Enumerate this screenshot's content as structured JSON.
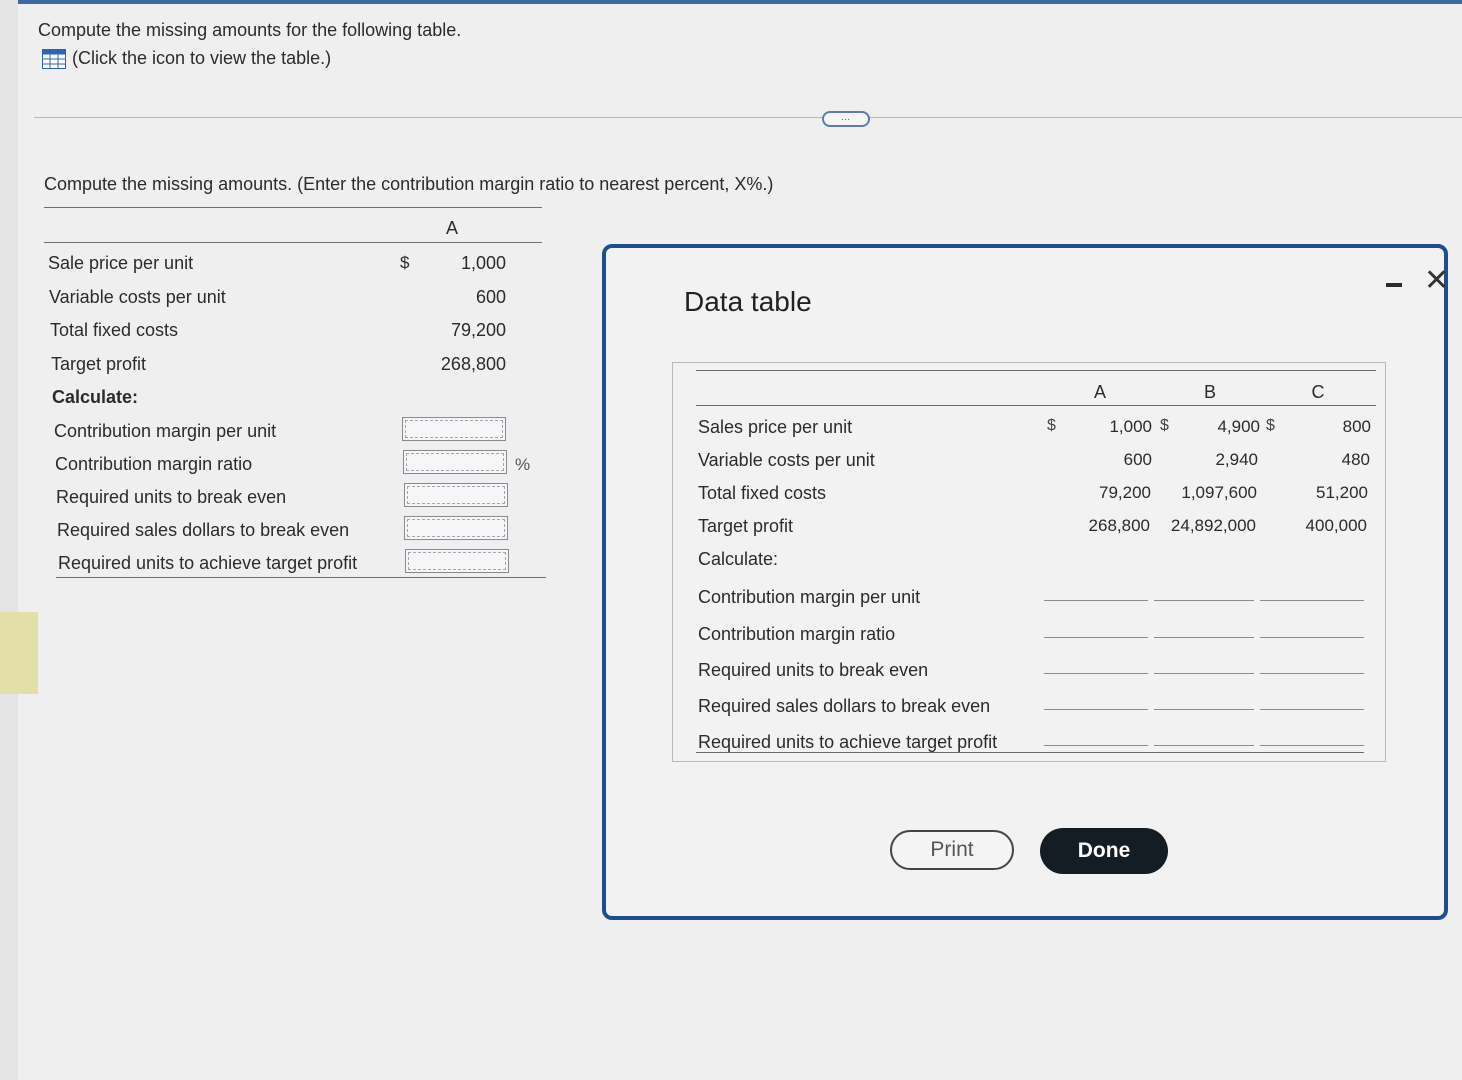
{
  "instruction": "Compute the missing amounts for the following table.",
  "icon_link": {
    "icon": "grid-table-icon",
    "label": "(Click the icon to view the table.)"
  },
  "more_button": "…",
  "question": "Compute the missing amounts. (Enter the contribution margin ratio to nearest percent, X%.)",
  "answer_table": {
    "column_header": "A",
    "dollar_sign": "$",
    "rows": [
      {
        "label": "Sale price per unit",
        "value": "1,000"
      },
      {
        "label": "Variable costs per unit",
        "value": "600"
      },
      {
        "label": "Total fixed costs",
        "value": "79,200"
      },
      {
        "label": "Target profit",
        "value": "268,800"
      }
    ],
    "calculate_label": "Calculate:",
    "inputs": [
      {
        "label": "Contribution margin per unit",
        "value": ""
      },
      {
        "label": "Contribution margin ratio",
        "value": "",
        "suffix": "%"
      },
      {
        "label": "Required units to break even",
        "value": ""
      },
      {
        "label": "Required sales dollars to break even",
        "value": ""
      },
      {
        "label": "Required units to achieve target profit",
        "value": ""
      }
    ]
  },
  "modal": {
    "title": "Data table",
    "minimize_icon": "minimize-icon",
    "close_icon": "close-icon",
    "close_glyph": "✕",
    "table": {
      "headers": [
        "A",
        "B",
        "C"
      ],
      "dollar_sign": "$",
      "rows": [
        {
          "label": "Sales price per unit",
          "values": [
            "1,000",
            "4,900",
            "800"
          ]
        },
        {
          "label": "Variable costs per unit",
          "values": [
            "600",
            "2,940",
            "480"
          ]
        },
        {
          "label": "Total fixed costs",
          "values": [
            "79,200",
            "1,097,600",
            "51,200"
          ]
        },
        {
          "label": "Target profit",
          "values": [
            "268,800",
            "24,892,000",
            "400,000"
          ]
        }
      ],
      "calculate_label": "Calculate:",
      "calc_rows": [
        "Contribution margin per unit",
        "Contribution margin ratio",
        "Required units to break even",
        "Required sales dollars to break even",
        "Required units to achieve target profit"
      ]
    },
    "print_label": "Print",
    "done_label": "Done"
  },
  "colors": {
    "modal_border": "#1e4f8c",
    "done_button": "#141c24",
    "icon_blue": "#2f63b5"
  }
}
